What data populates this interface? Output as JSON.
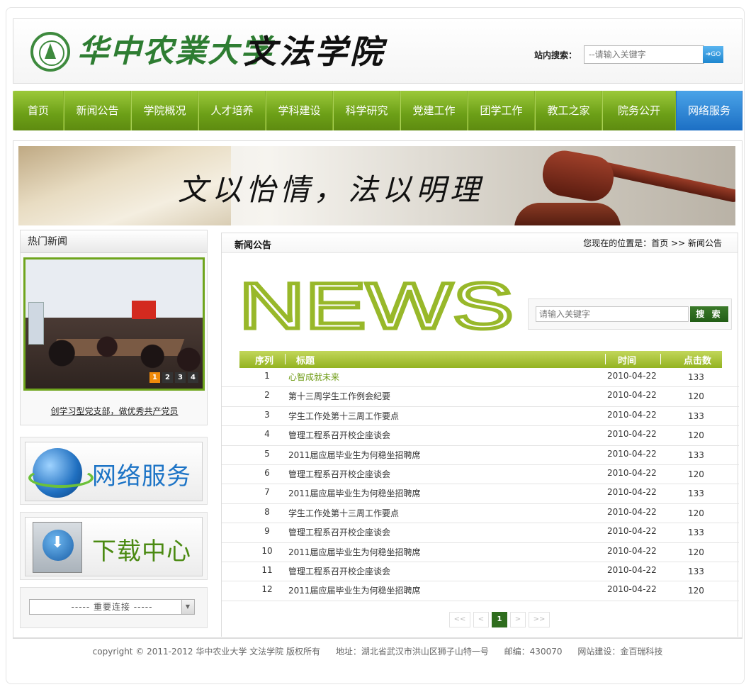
{
  "header": {
    "university_name": "华中农業大学",
    "college_name": "文法学院",
    "search_label": "站内搜索：",
    "search_placeholder": "--请输入关键字",
    "search_button": "GO"
  },
  "nav": {
    "items": [
      "首页",
      "新闻公告",
      "学院概况",
      "人才培养",
      "学科建设",
      "科学研究",
      "党建工作",
      "团学工作",
      "教工之家",
      "院务公开",
      "网络服务"
    ],
    "active_index": 10,
    "accent_color": "#6c9f17",
    "active_color": "#1c6fc4"
  },
  "banner": {
    "slogan": "文以怡情，法以明理"
  },
  "hot_news": {
    "title": "热门新闻",
    "pages": [
      "1",
      "2",
      "3",
      "4"
    ],
    "active_page": 0,
    "caption": "创学习型党支部，做优秀共产党员"
  },
  "services": {
    "network": "网络服务",
    "download": "下载中心"
  },
  "links": {
    "select_value": "----- 重要连接 -----"
  },
  "content": {
    "title": "新闻公告",
    "breadcrumb": "您现在的位置是：首页 >> 新闻公告",
    "news_label": "NEWS",
    "search_placeholder": "请输入关键字",
    "search_button": "搜 索",
    "columns": [
      "序列",
      "标题",
      "时间",
      "点击数"
    ],
    "rows": [
      {
        "idx": "1",
        "title": "心智成就未来",
        "date": "2010-04-22",
        "hits": "133"
      },
      {
        "idx": "2",
        "title": "第十三周学生工作例会纪要",
        "date": "2010-04-22",
        "hits": "120"
      },
      {
        "idx": "3",
        "title": "学生工作处第十三周工作要点",
        "date": "2010-04-22",
        "hits": "133"
      },
      {
        "idx": "4",
        "title": "管理工程系召开校企座谈会",
        "date": "2010-04-22",
        "hits": "120"
      },
      {
        "idx": "5",
        "title": "2011届应届毕业生为何稳坐招聘席",
        "date": "2010-04-22",
        "hits": "133"
      },
      {
        "idx": "6",
        "title": "管理工程系召开校企座谈会",
        "date": "2010-04-22",
        "hits": "120"
      },
      {
        "idx": "7",
        "title": "2011届应届毕业生为何稳坐招聘席",
        "date": "2010-04-22",
        "hits": "133"
      },
      {
        "idx": "8",
        "title": "学生工作处第十三周工作要点",
        "date": "2010-04-22",
        "hits": "120"
      },
      {
        "idx": "9",
        "title": "管理工程系召开校企座谈会",
        "date": "2010-04-22",
        "hits": "133"
      },
      {
        "idx": "10",
        "title": "2011届应届毕业生为何稳坐招聘席",
        "date": "2010-04-22",
        "hits": "120"
      },
      {
        "idx": "11",
        "title": "管理工程系召开校企座谈会",
        "date": "2010-04-22",
        "hits": "133"
      },
      {
        "idx": "12",
        "title": "2011届应届毕业生为何稳坐招聘席",
        "date": "2010-04-22",
        "hits": "120"
      }
    ],
    "pager": {
      "first": "<<",
      "prev": "<",
      "current": "1",
      "next": ">",
      "last": ">>"
    }
  },
  "footer": {
    "copyright": "copyright © 2011-2012 华中农业大学 文法学院   版权所有",
    "address": "地址：湖北省武汉市洪山区狮子山特一号",
    "postcode": "邮编：430070",
    "builder": "网站建设：金百瑞科技"
  }
}
